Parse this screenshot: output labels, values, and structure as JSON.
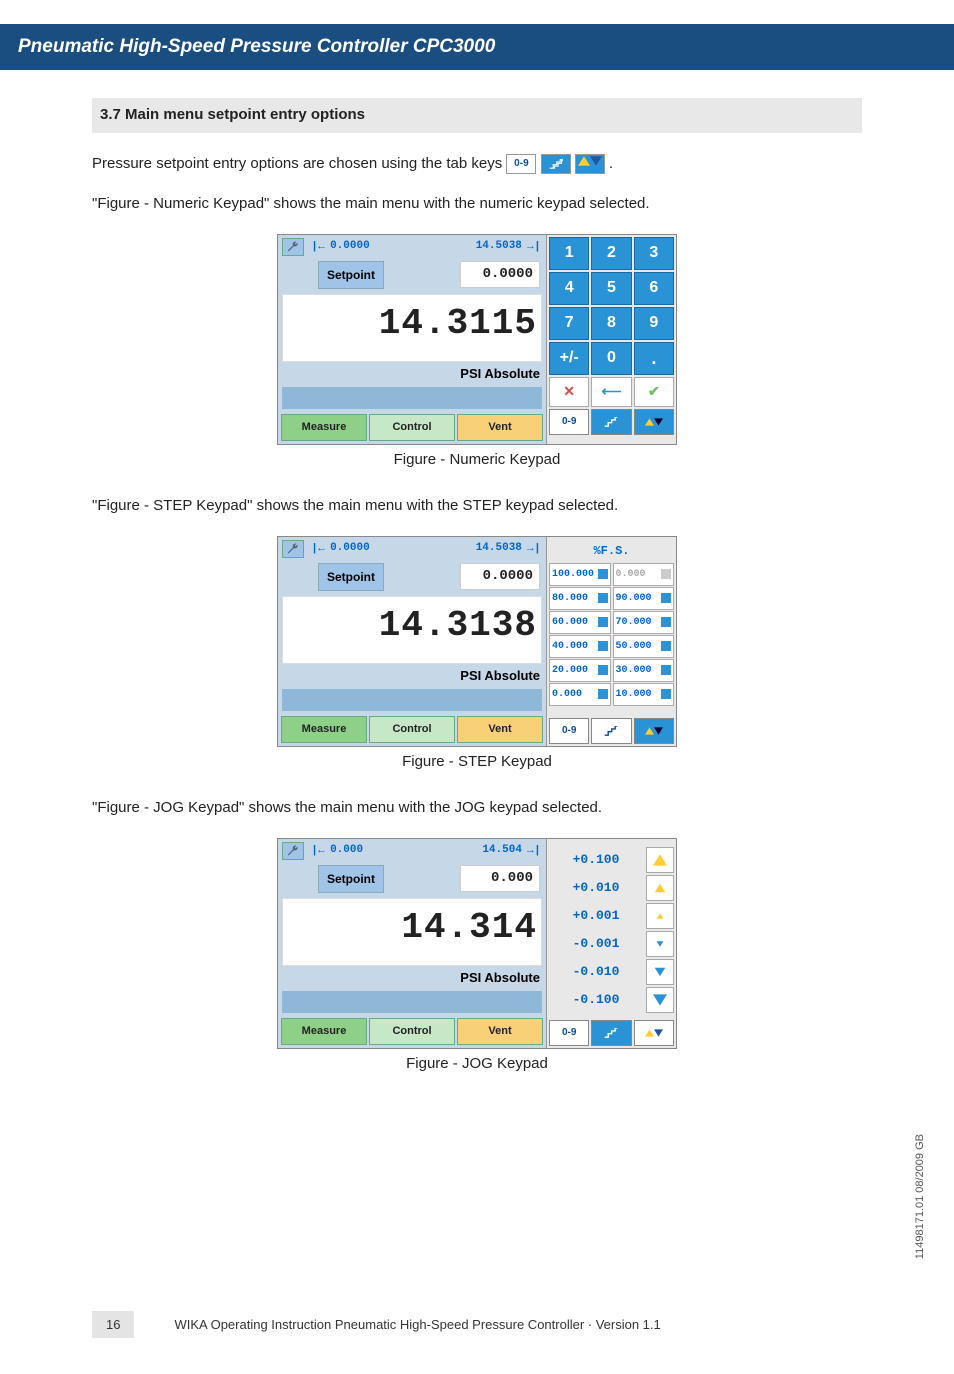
{
  "header": {
    "title": "Pneumatic High-Speed Pressure Controller CPC3000"
  },
  "section": {
    "heading": "3.7 Main menu setpoint entry options"
  },
  "intro": {
    "text_before_keys": "Pressure setpoint entry options are chosen using the tab keys ",
    "text_after_keys": "."
  },
  "tabkeys": {
    "num": "0-9"
  },
  "para1": "\"Figure - Numeric Keypad\" shows the main menu with the numeric keypad selected.",
  "caption1": "Figure - Numeric Keypad",
  "para2": "\"Figure - STEP Keypad\" shows the main menu with the STEP keypad selected.",
  "caption2": "Figure - STEP Keypad",
  "para3": "\"Figure - JOG Keypad\" shows the main menu with the JOG keypad selected.",
  "caption3": "Figure - JOG Keypad",
  "screen_common": {
    "setpoint_label": "Setpoint",
    "units": "PSI Absolute",
    "modes": {
      "measure": "Measure",
      "control": "Control",
      "vent": "Vent"
    },
    "tab_num": "0-9"
  },
  "fig1": {
    "range_low": "0.0000",
    "range_high": "14.5038",
    "setpoint_val": "0.0000",
    "reading": "14.3115",
    "keys": [
      "1",
      "2",
      "3",
      "4",
      "5",
      "6",
      "7",
      "8",
      "9",
      "+/-",
      "0",
      "."
    ]
  },
  "fig2": {
    "range_low": "0.0000",
    "range_high": "14.5038",
    "setpoint_val": "0.0000",
    "reading": "14.3138",
    "step_title": "%F.S.",
    "steps": [
      [
        "100.000",
        "0.000",
        true
      ],
      [
        "80.000",
        "90.000",
        false
      ],
      [
        "60.000",
        "70.000",
        false
      ],
      [
        "40.000",
        "50.000",
        false
      ],
      [
        "20.000",
        "30.000",
        false
      ],
      [
        "0.000",
        "10.000",
        false
      ]
    ]
  },
  "fig3": {
    "range_low": "0.000",
    "range_high": "14.504",
    "setpoint_val": "0.000",
    "reading": "14.314",
    "jogs": [
      "+0.100",
      "+0.010",
      "+0.001",
      "-0.001",
      "-0.010",
      "-0.100"
    ]
  },
  "footer": {
    "page": "16",
    "text": "WIKA Operating Instruction Pneumatic High-Speed Pressure Controller · Version 1.1"
  },
  "side": "11498171.01 08/2009  GB"
}
